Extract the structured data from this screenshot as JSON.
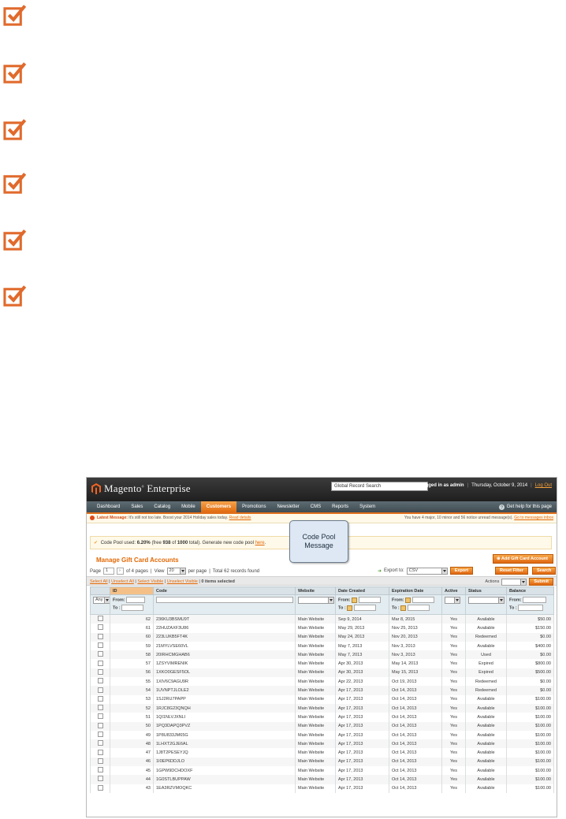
{
  "checklist": {
    "count": 6,
    "accent_color": "#e06a2c",
    "icon": "checkbox-check-icon"
  },
  "header": {
    "logo_brand": "Magento",
    "logo_product": "Enterprise",
    "global_search": "Global Record Search",
    "logged_in": "Logged in as admin",
    "date": "Thursday, October 9, 2014",
    "logout": "Log Out"
  },
  "nav": {
    "items": [
      "Dashboard",
      "Sales",
      "Catalog",
      "Mobile",
      "Customers",
      "Promotions",
      "Newsletter",
      "CMS",
      "Reports",
      "System"
    ],
    "active": "Customers",
    "help": "Get help for this page"
  },
  "messages": {
    "latest_label": "Latest Message:",
    "latest_text": "It's still not too late. Boost your 2014 Holiday sales today.",
    "read_details": "Read details",
    "right_text": "You have 4 major, 10 minor and 56 notice unread message(s).",
    "go_inbox": "Go to messages inbox"
  },
  "code_pool": {
    "prefix": "Code Pool used:",
    "percent": "6.20%",
    "free_prefix": "(free",
    "free": "938",
    "of": "of",
    "total": "1000",
    "total_suffix": "total). Generate new code pool",
    "link": "here",
    "period": "."
  },
  "callout": {
    "line1": "Code Pool",
    "line2": "Message"
  },
  "page": {
    "title": "Manage Gift Card Accounts",
    "add_button": "Add Gift Card Account"
  },
  "pager": {
    "page_label": "Page",
    "page_value": "1",
    "of_pages": "of 4 pages",
    "view_label": "View",
    "view_value": "20",
    "per_page": "per page",
    "total": "Total 62 records found",
    "export_label": "Export to:",
    "export_value": "CSV",
    "export_button": "Export",
    "reset_button": "Reset Filter",
    "search_button": "Search"
  },
  "massaction": {
    "select_all": "Select All",
    "unselect_all": "Unselect All",
    "select_visible": "Select Visible",
    "unselect_visible": "Unselect Visible",
    "selected": "0 items selected",
    "actions_label": "Actions",
    "submit": "Submit"
  },
  "grid": {
    "columns": [
      "",
      "ID",
      "Code",
      "Website",
      "Date Created",
      "Expiration Date",
      "Active",
      "Status",
      "Balance"
    ],
    "filter": {
      "any": "Any",
      "from": "From:",
      "to": "To :"
    },
    "rows": [
      [
        "62",
        "236KU3BSMU9T",
        "Main Website",
        "Sep 9, 2014",
        "Mar 8, 2015",
        "Yes",
        "Available",
        "$50.00"
      ],
      [
        "61",
        "22HUZAXF3U86",
        "Main Website",
        "May 29, 2013",
        "Nov 25, 2013",
        "Yes",
        "Available",
        "$150.00"
      ],
      [
        "60",
        "223LUKB5FT4K",
        "Main Website",
        "May 24, 2013",
        "Nov 20, 2013",
        "Yes",
        "Redeemed",
        "$0.00"
      ],
      [
        "59",
        "21MYLVSE60VL",
        "Main Website",
        "May 7, 2013",
        "Nov 3, 2013",
        "Yes",
        "Available",
        "$400.00"
      ],
      [
        "58",
        "20IRHCMGHAB6",
        "Main Website",
        "May 7, 2013",
        "Nov 3, 2013",
        "Yes",
        "Used",
        "$0.00"
      ],
      [
        "57",
        "1ZSYVIMRENIK",
        "Main Website",
        "Apr 30, 2013",
        "May 14, 2013",
        "Yes",
        "Expired",
        "$800.00"
      ],
      [
        "56",
        "1XKO0GESF5OL",
        "Main Website",
        "Apr 30, 2013",
        "May 15, 2013",
        "Yes",
        "Expired",
        "$500.00"
      ],
      [
        "55",
        "1XIV6C9AGU9R",
        "Main Website",
        "Apr 22, 2013",
        "Oct 19, 2013",
        "Yes",
        "Redeemed",
        "$0.00"
      ],
      [
        "54",
        "1UVNPTJLOLE2",
        "Main Website",
        "Apr 17, 2013",
        "Oct 14, 2013",
        "Yes",
        "Redeemed",
        "$0.00"
      ],
      [
        "53",
        "1SJ2RU7PAPP",
        "Main Website",
        "Apr 17, 2013",
        "Oct 14, 2013",
        "Yes",
        "Available",
        "$100.00"
      ],
      [
        "52",
        "1RJC8G23QNQH",
        "Main Website",
        "Apr 17, 2013",
        "Oct 14, 2013",
        "Yes",
        "Available",
        "$100.00"
      ],
      [
        "51",
        "1QI1NLVJXNLI",
        "Main Website",
        "Apr 17, 2013",
        "Oct 14, 2013",
        "Yes",
        "Available",
        "$100.00"
      ],
      [
        "50",
        "1PQ3DAPQ3PVZ",
        "Main Website",
        "Apr 17, 2013",
        "Oct 14, 2013",
        "Yes",
        "Available",
        "$100.00"
      ],
      [
        "49",
        "1P8U833JM65G",
        "Main Website",
        "Apr 17, 2013",
        "Oct 14, 2013",
        "Yes",
        "Available",
        "$100.00"
      ],
      [
        "48",
        "1LHXT2GJE6AL",
        "Main Website",
        "Apr 17, 2013",
        "Oct 14, 2013",
        "Yes",
        "Available",
        "$100.00"
      ],
      [
        "47",
        "1J8T2PESEYJQ",
        "Main Website",
        "Apr 17, 2013",
        "Oct 14, 2013",
        "Yes",
        "Available",
        "$100.00"
      ],
      [
        "46",
        "1I0EP6DDJLO",
        "Main Website",
        "Apr 17, 2013",
        "Oct 14, 2013",
        "Yes",
        "Available",
        "$100.00"
      ],
      [
        "45",
        "1GPW9DCHDOXF",
        "Main Website",
        "Apr 17, 2013",
        "Oct 14, 2013",
        "Yes",
        "Available",
        "$100.00"
      ],
      [
        "44",
        "1G0STLBUPPAW",
        "Main Website",
        "Apr 17, 2013",
        "Oct 14, 2013",
        "Yes",
        "Available",
        "$100.00"
      ],
      [
        "43",
        "1EA3RZVMOQKC",
        "Main Website",
        "Apr 17, 2013",
        "Oct 14, 2013",
        "Yes",
        "Available",
        "$100.00"
      ]
    ]
  }
}
